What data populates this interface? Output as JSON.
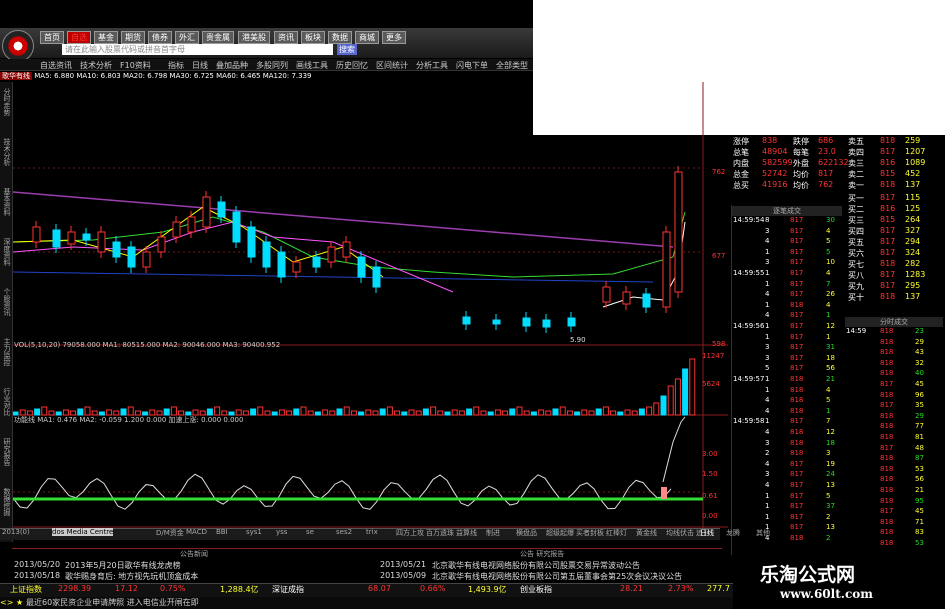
{
  "toolbar": {
    "buttons": [
      "首页",
      "自选",
      "基金",
      "期货",
      "债券",
      "外汇",
      "贵金属",
      "港美股",
      "资讯",
      "板块",
      "数据",
      "商城",
      "更多"
    ],
    "search_placeholder": "请在此输入股票代码或拼音首字母",
    "search_button": "搜索"
  },
  "menu": [
    "自选资讯",
    "技术分析",
    "F10资料",
    "指标",
    "日线",
    "叠加品种",
    "多股同列",
    "画线工具",
    "历史回忆",
    "区间统计",
    "分析工具",
    "闪电下单",
    "全部类型"
  ],
  "stock_title": "歌华有线",
  "ma_line": "MA5: 6.880  MA10: 6.803  MA20: 6.798  MA30: 6.725  MA60: 6.465  MA120: 7.339",
  "left_tabs": [
    "分时走势",
    "技术分析",
    "基本资料",
    "深度资料",
    "个股资讯",
    "主力监控",
    "行业对比",
    "研究报告",
    "数据挖掘"
  ],
  "price_axis": [
    "762",
    "677",
    "598",
    "11247",
    "5624",
    "3.00",
    "1.50",
    "0.61",
    "0.00"
  ],
  "vol_label": "VOL(5,10,20)  79058.000  MA1: 80515.000  MA2: 90046.000  MA3: 90400.952",
  "macd_label": "功能线 MA1: 0.476  MA2: -0.059  1.200  0.000  加速上涨: 0.000  0.000",
  "low_label": "5.90",
  "quote": {
    "rows": [
      {
        "l1": "涨停",
        "v1": "838",
        "l2": "跌停",
        "v2": "686",
        "l3": "卖五",
        "p": "818",
        "q": "259"
      },
      {
        "l1": "总笔",
        "v1": "48904",
        "l2": "每笔",
        "v2": "23.0",
        "l3": "卖四",
        "p": "817",
        "q": "1207"
      },
      {
        "l1": "内盘",
        "v1": "582599",
        "l2": "外盘",
        "v2": "622132",
        "l3": "卖三",
        "p": "816",
        "q": "1089"
      },
      {
        "l1": "总金",
        "v1": "52742",
        "l2": "均价",
        "v2": "817",
        "l3": "卖二",
        "p": "815",
        "q": "452"
      },
      {
        "l1": "总买",
        "v1": "41916",
        "l2": "均价",
        "v2": "762",
        "l3": "卖一",
        "p": "818",
        "q": "137"
      }
    ],
    "bids": [
      {
        "l": "买一",
        "p": "817",
        "q": "115"
      },
      {
        "l": "买二",
        "p": "816",
        "q": "125"
      },
      {
        "l": "买三",
        "p": "815",
        "q": "264"
      },
      {
        "l": "买四",
        "p": "817",
        "q": "327"
      },
      {
        "l": "买五",
        "p": "817",
        "q": "294"
      },
      {
        "l": "买六",
        "p": "817",
        "q": "324"
      },
      {
        "l": "买七",
        "p": "818",
        "q": "282"
      },
      {
        "l": "买八",
        "p": "817",
        "q": "1283"
      },
      {
        "l": "买九",
        "p": "817",
        "q": "295"
      },
      {
        "l": "买十",
        "p": "818",
        "q": "137"
      }
    ]
  },
  "trades_header": "逐笔成交",
  "trades": [
    {
      "t": "14:59:54",
      "n": "8",
      "p": "817",
      "v": "30"
    },
    {
      "t": "",
      "n": "3",
      "p": "817",
      "v": "4"
    },
    {
      "t": "",
      "n": "4",
      "p": "817",
      "v": "5"
    },
    {
      "t": "",
      "n": "1",
      "p": "817",
      "v": "5"
    },
    {
      "t": "",
      "n": "3",
      "p": "817",
      "v": "10"
    },
    {
      "t": "14:59:55",
      "n": "1",
      "p": "817",
      "v": "4"
    },
    {
      "t": "",
      "n": "1",
      "p": "817",
      "v": "7"
    },
    {
      "t": "",
      "n": "4",
      "p": "817",
      "v": "26"
    },
    {
      "t": "",
      "n": "1",
      "p": "818",
      "v": "4"
    },
    {
      "t": "",
      "n": "4",
      "p": "817",
      "v": "1"
    },
    {
      "t": "14:59:56",
      "n": "1",
      "p": "817",
      "v": "12"
    },
    {
      "t": "",
      "n": "1",
      "p": "817",
      "v": "1"
    },
    {
      "t": "",
      "n": "3",
      "p": "817",
      "v": "31"
    },
    {
      "t": "",
      "n": "3",
      "p": "817",
      "v": "18"
    },
    {
      "t": "",
      "n": "5",
      "p": "817",
      "v": "56"
    },
    {
      "t": "14:59:57",
      "n": "1",
      "p": "818",
      "v": "21"
    },
    {
      "t": "",
      "n": "1",
      "p": "818",
      "v": "4"
    },
    {
      "t": "",
      "n": "4",
      "p": "818",
      "v": "5"
    },
    {
      "t": "",
      "n": "4",
      "p": "818",
      "v": "1"
    },
    {
      "t": "14:59:58",
      "n": "1",
      "p": "817",
      "v": "7"
    },
    {
      "t": "",
      "n": "4",
      "p": "818",
      "v": "12"
    },
    {
      "t": "",
      "n": "3",
      "p": "818",
      "v": "18"
    },
    {
      "t": "",
      "n": "2",
      "p": "818",
      "v": "3"
    },
    {
      "t": "",
      "n": "4",
      "p": "817",
      "v": "19"
    },
    {
      "t": "",
      "n": "3",
      "p": "817",
      "v": "24"
    },
    {
      "t": "",
      "n": "4",
      "p": "817",
      "v": "13"
    },
    {
      "t": "",
      "n": "1",
      "p": "817",
      "v": "5"
    },
    {
      "t": "",
      "n": "1",
      "p": "817",
      "v": "37"
    },
    {
      "t": "",
      "n": "1",
      "p": "817",
      "v": "2"
    },
    {
      "t": "",
      "n": "1",
      "p": "817",
      "v": "13"
    },
    {
      "t": "",
      "n": "4",
      "p": "818",
      "v": "2"
    }
  ],
  "trades2_header": "分时成交",
  "trades2": [
    {
      "t": "14:59",
      "p": "818",
      "v": "23"
    },
    {
      "t": "",
      "p": "818",
      "v": "29"
    },
    {
      "t": "",
      "p": "818",
      "v": "43"
    },
    {
      "t": "",
      "p": "818",
      "v": "32"
    },
    {
      "t": "",
      "p": "818",
      "v": "40"
    },
    {
      "t": "",
      "p": "817",
      "v": "45"
    },
    {
      "t": "",
      "p": "818",
      "v": "96"
    },
    {
      "t": "",
      "p": "817",
      "v": "35"
    },
    {
      "t": "",
      "p": "818",
      "v": "29"
    },
    {
      "t": "",
      "p": "818",
      "v": "77"
    },
    {
      "t": "",
      "p": "818",
      "v": "81"
    },
    {
      "t": "",
      "p": "817",
      "v": "48"
    },
    {
      "t": "",
      "p": "818",
      "v": "87"
    },
    {
      "t": "",
      "p": "818",
      "v": "53"
    },
    {
      "t": "",
      "p": "818",
      "v": "56"
    },
    {
      "t": "",
      "p": "818",
      "v": "21"
    },
    {
      "t": "",
      "p": "818",
      "v": "95"
    },
    {
      "t": "",
      "p": "817",
      "v": "45"
    },
    {
      "t": "",
      "p": "818",
      "v": "71"
    },
    {
      "t": "",
      "p": "818",
      "v": "83"
    },
    {
      "t": "",
      "p": "818",
      "v": "53"
    }
  ],
  "bottom_tabs": [
    "2013(0)",
    "dos Media Centre",
    "D/M资金",
    "MACD",
    "BBI",
    "sys1",
    "yss",
    "se",
    "ses2",
    "trix",
    "四方上攻",
    "百万遗珠",
    "益算线",
    "制进",
    "横盘品",
    "超级起爆",
    "买者封板",
    "红棒灯",
    "黄金线",
    "均线伏击",
    "追日",
    "龙腾",
    "其他"
  ],
  "bottom_right": "日线",
  "news_left_header": "公告新闻",
  "news_right_header": "公告 研究报告",
  "news": [
    {
      "d": "2013/05/20",
      "t": "2013年5月20日歌华有线龙虎榜"
    },
    {
      "d": "2013/05/18",
      "t": "歌华赐身育后: 地方视先玩机顶盒成本"
    }
  ],
  "news_right": [
    {
      "d": "2013/05/21",
      "t": "北京歌华有线电视网络股份有限公司股票交易异常波动公告"
    },
    {
      "d": "2013/05/09",
      "t": "北京歌华有线电视网络股份有限公司第五届董事会第25次会议决议公告"
    }
  ],
  "status": {
    "sh_name": "上证指数",
    "sh_val": "2298.39",
    "sh_chg": "17.12",
    "sh_pct": "0.75%",
    "sh_amt": "1,288.4亿",
    "sz_name": "深证成指",
    "sz_val": "68.07",
    "sz_pct": "0.66%",
    "sz_amt": "1,493.9亿",
    "cy_name": "创业板指",
    "cy_val": "28.21",
    "cy_pct": "2.73%",
    "last": "277.7"
  },
  "ticker": "最近60家民资企业申请牌照 进入电信业开闸在即",
  "watermark": {
    "title": "乐淘公式网",
    "url": "www.60lt.com"
  },
  "colors": {
    "up": "#ff3333",
    "down": "#00ddff",
    "ma5": "#ffffff",
    "ma10": "#ffff00",
    "ma20": "#ff55ff",
    "ma60": "#33dd33",
    "long": "#9b3fb0"
  }
}
